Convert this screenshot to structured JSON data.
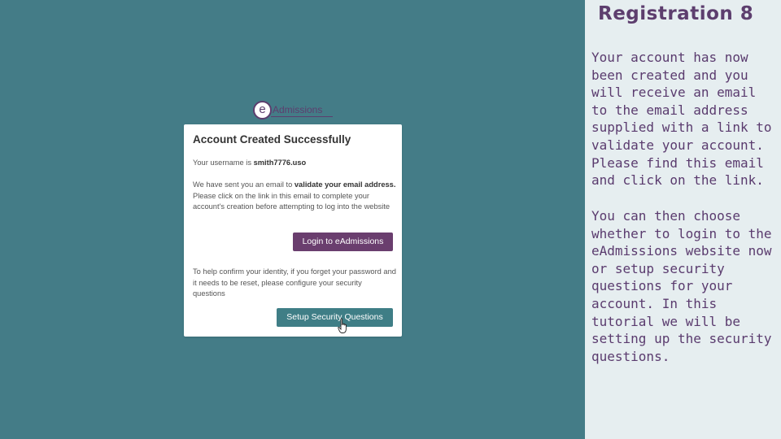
{
  "slide": {
    "title": "Registration 8",
    "paragraphs": [
      "Your account has now been created and you will receive an email to the email address supplied with a link to validate your account. Please find this email and click on the link.",
      "You can then choose whether to login to the eAdmissions website now or setup security questions for your account. In this tutorial we will be setting up the security questions."
    ]
  },
  "logo": {
    "letter": "e",
    "text": "Admissions"
  },
  "dialog": {
    "title": "Account Created Successfully",
    "username_prefix": "Your username is ",
    "username": "smith7776.uso",
    "validate_pre": "We have sent you an email to ",
    "validate_bold": "validate your email address.",
    "validate_post": " Please click on the link in this email to complete your account's creation before attempting to log into the website",
    "login_button": "Login to eAdmissions",
    "security_text": "To help confirm your identity, if you forget your password and it needs to be reset, please configure your security questions",
    "security_button": "Setup Security Questions"
  },
  "colors": {
    "left_background": "#447c87",
    "right_background": "#e6eef0",
    "brand_purple": "#6a3e6e",
    "teal_button": "#3f7e86"
  },
  "icons": {
    "cursor": "hand-pointer-icon"
  }
}
